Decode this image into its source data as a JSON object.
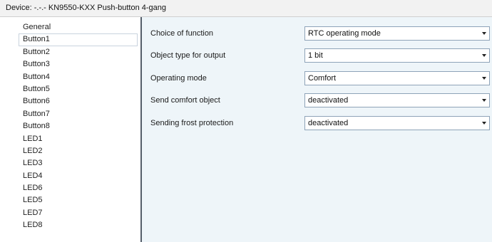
{
  "title": "Device: -.-.-  KN9550-KXX Push-button 4-gang",
  "sidebar": {
    "items": [
      {
        "label": "General"
      },
      {
        "label": "Button1",
        "selected": true
      },
      {
        "label": "Button2"
      },
      {
        "label": "Button3"
      },
      {
        "label": "Button4"
      },
      {
        "label": "Button5"
      },
      {
        "label": "Button6"
      },
      {
        "label": "Button7"
      },
      {
        "label": "Button8"
      },
      {
        "label": "LED1"
      },
      {
        "label": "LED2"
      },
      {
        "label": "LED3"
      },
      {
        "label": "LED4"
      },
      {
        "label": "LED6"
      },
      {
        "label": "LED5"
      },
      {
        "label": "LED7"
      },
      {
        "label": "LED8"
      }
    ]
  },
  "params": [
    {
      "label": "Choice of function",
      "value": "RTC operating mode"
    },
    {
      "label": "Object type for output",
      "value": "1 bit"
    },
    {
      "label": "Operating mode",
      "value": "Comfort"
    },
    {
      "label": "Send comfort object",
      "value": "deactivated"
    },
    {
      "label": "Sending frost protection",
      "value": "deactivated"
    }
  ]
}
